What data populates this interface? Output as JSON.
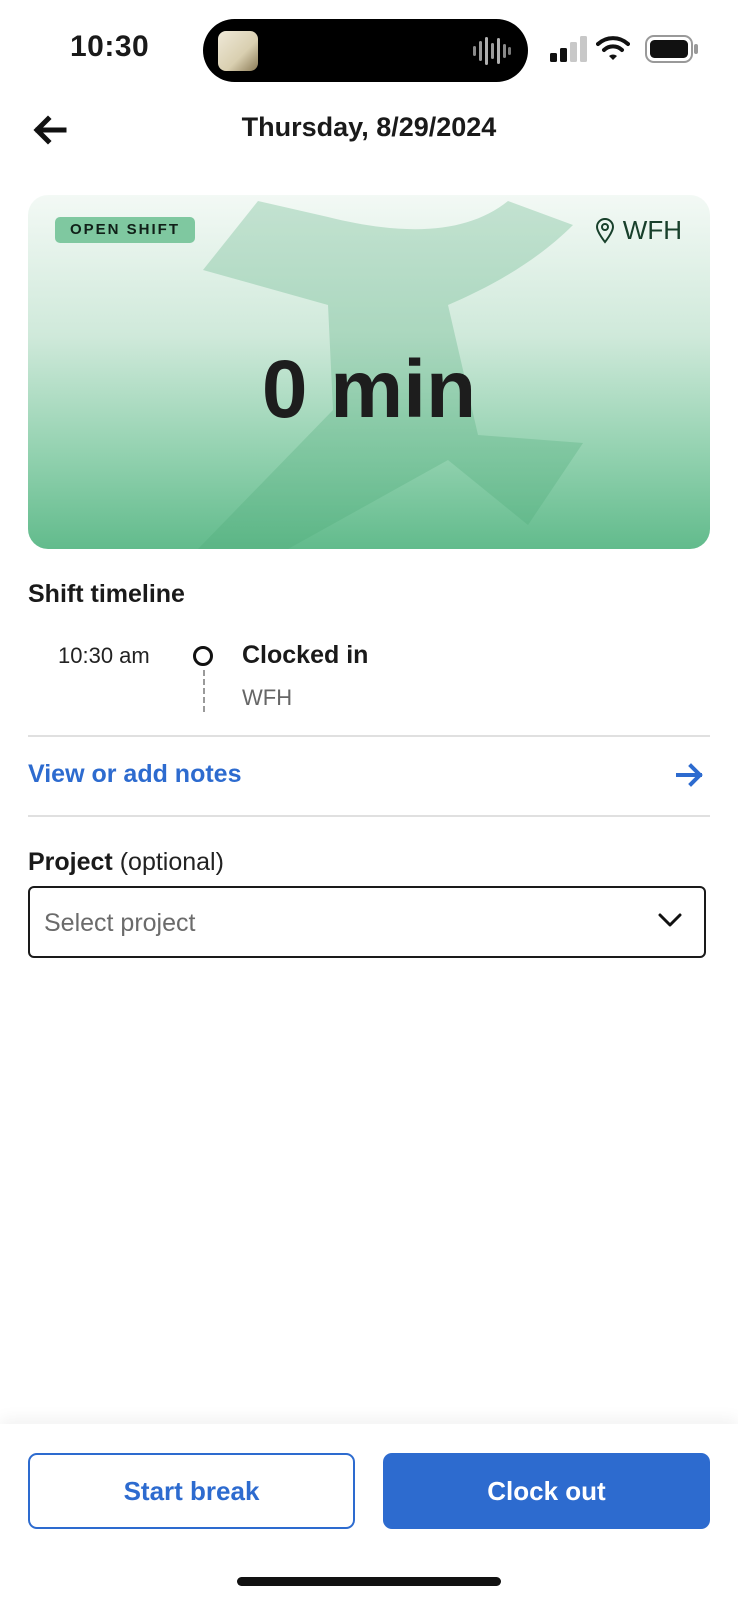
{
  "status_bar": {
    "time": "10:30",
    "icons": [
      "signal-icon",
      "wifi-icon",
      "battery-icon"
    ]
  },
  "header": {
    "title": "Thursday, 8/29/2024",
    "back_icon": "back-arrow-icon"
  },
  "shift_card": {
    "badge": "OPEN SHIFT",
    "location": "WFH",
    "location_icon": "location-pin-icon",
    "duration": "0 min"
  },
  "timeline": {
    "title": "Shift timeline",
    "events": [
      {
        "time": "10:30 am",
        "label": "Clocked in",
        "location": "WFH"
      }
    ]
  },
  "notes": {
    "link_label": "View or add notes",
    "arrow_icon": "arrow-right-icon"
  },
  "project": {
    "label": "Project",
    "optional": " (optional)",
    "placeholder": "Select project",
    "chevron_icon": "chevron-down-icon"
  },
  "actions": {
    "start_break": "Start break",
    "clock_out": "Clock out"
  },
  "colors": {
    "accent": "#2d6bcf",
    "badge": "#7fc8a0",
    "card_green": "#62bb8c"
  }
}
